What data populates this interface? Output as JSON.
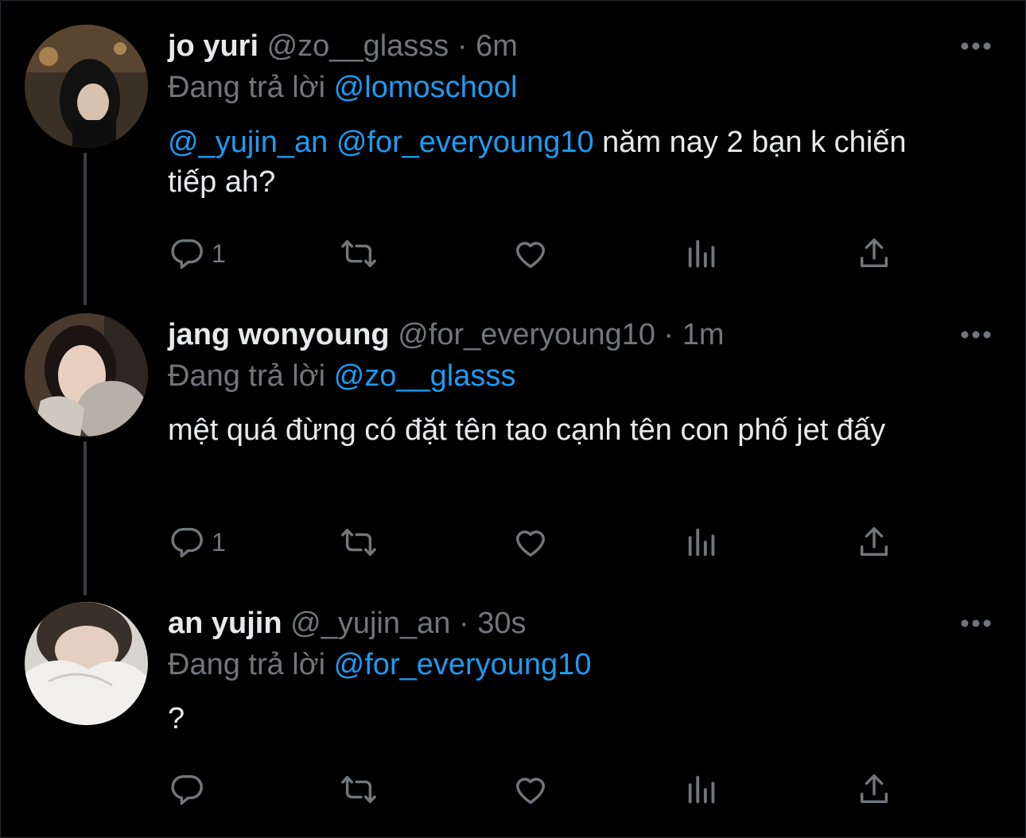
{
  "colors": {
    "background": "#000000",
    "text": "#e7e9ea",
    "muted": "#71767b",
    "link": "#1d9bf0",
    "thread_line": "#3a3e42"
  },
  "icons": {
    "reply": "reply-bubble-icon",
    "retweet": "retweet-arrows-icon",
    "like": "heart-icon",
    "views": "bar-chart-icon",
    "share": "share-upload-icon",
    "more": "more-dots-icon"
  },
  "tweets": [
    {
      "name": "jo yuri",
      "handle": "@zo__glasss",
      "separator": "·",
      "time": "6m",
      "reply_prefix": "Đang trả lời",
      "reply_to": "@lomoschool",
      "mentions": [
        "@_yujin_an",
        "@for_everyoung10"
      ],
      "text": "năm nay 2 bạn k chiến tiếp ah?",
      "reply_count": "1"
    },
    {
      "name": "jang wonyoung",
      "handle": "@for_everyoung10",
      "separator": "·",
      "time": "1m",
      "reply_prefix": "Đang trả lời",
      "reply_to": "@zo__glasss",
      "text": "mệt quá đừng có đặt tên tao cạnh tên con phố jet đấy",
      "reply_count": "1"
    },
    {
      "name": "an yujin",
      "handle": "@_yujin_an",
      "separator": "·",
      "time": "30s",
      "reply_prefix": "Đang trả lời",
      "reply_to": "@for_everyoung10",
      "text": "?",
      "reply_count": ""
    }
  ]
}
